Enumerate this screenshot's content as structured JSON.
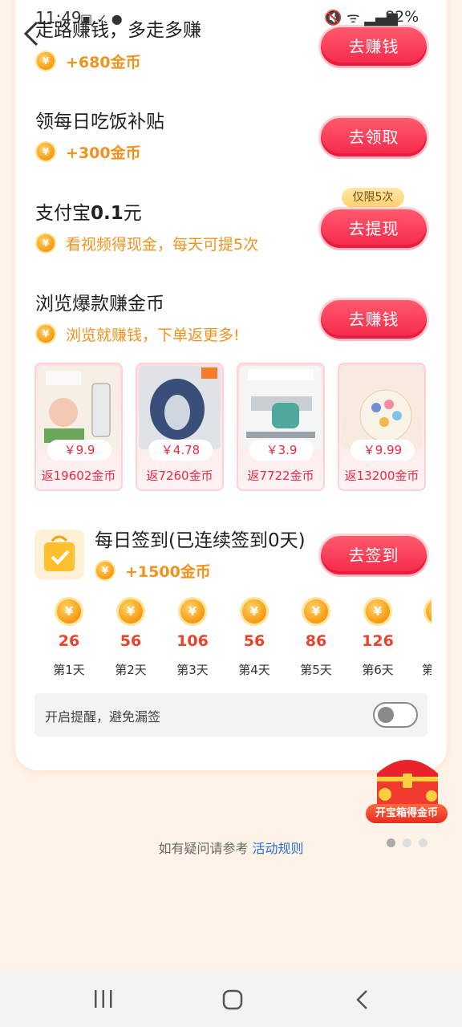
{
  "status_bar": {
    "time": "11:49",
    "background_icons": "▣ ✓ ●",
    "indicators": "🔇 ᯤ ▂▄▆",
    "battery": "82%"
  },
  "tasks": [
    {
      "title": "走路赚钱，多走多赚",
      "reward": "+680金币",
      "button": "去赚钱"
    },
    {
      "title": "领每日吃饭补贴",
      "reward": "+300金币",
      "button": "去领取"
    },
    {
      "title_prefix": "支付宝",
      "title_bold": "0.1",
      "title_suffix": "元",
      "reward": "看视频得现金，每天可提5次",
      "button": "去提现",
      "tag": "仅限5次"
    },
    {
      "title": "浏览爆款赚金币",
      "reward": "浏览就赚钱，下单返更多!",
      "button": "去赚钱"
    }
  ],
  "products": [
    {
      "price": "￥9.9",
      "rebate": "返19602金币"
    },
    {
      "price": "￥4.78",
      "rebate": "返7260金币"
    },
    {
      "price": "￥3.9",
      "rebate": "返7722金币"
    },
    {
      "price": "￥9.99",
      "rebate": "返13200金币"
    }
  ],
  "checkin": {
    "title": "每日签到(已连续签到0天)",
    "reward": "+1500金币",
    "button": "去签到",
    "days": [
      {
        "amount": "26",
        "label": "第1天"
      },
      {
        "amount": "56",
        "label": "第2天"
      },
      {
        "amount": "106",
        "label": "第3天"
      },
      {
        "amount": "56",
        "label": "第4天"
      },
      {
        "amount": "86",
        "label": "第5天"
      },
      {
        "amount": "126",
        "label": "第6天"
      }
    ],
    "partial_day_label": "第"
  },
  "reminder": {
    "label": "开启提醒，避免漏签",
    "enabled": false
  },
  "treasure": {
    "label": "开宝箱得金币"
  },
  "footer": {
    "question": "如有疑问请参考 ",
    "link": "活动规则"
  },
  "coin_glyph": "¥",
  "colors": {
    "accent_red": "#f6284b",
    "gold": "#f0931e",
    "link_blue": "#2a6fd6"
  }
}
